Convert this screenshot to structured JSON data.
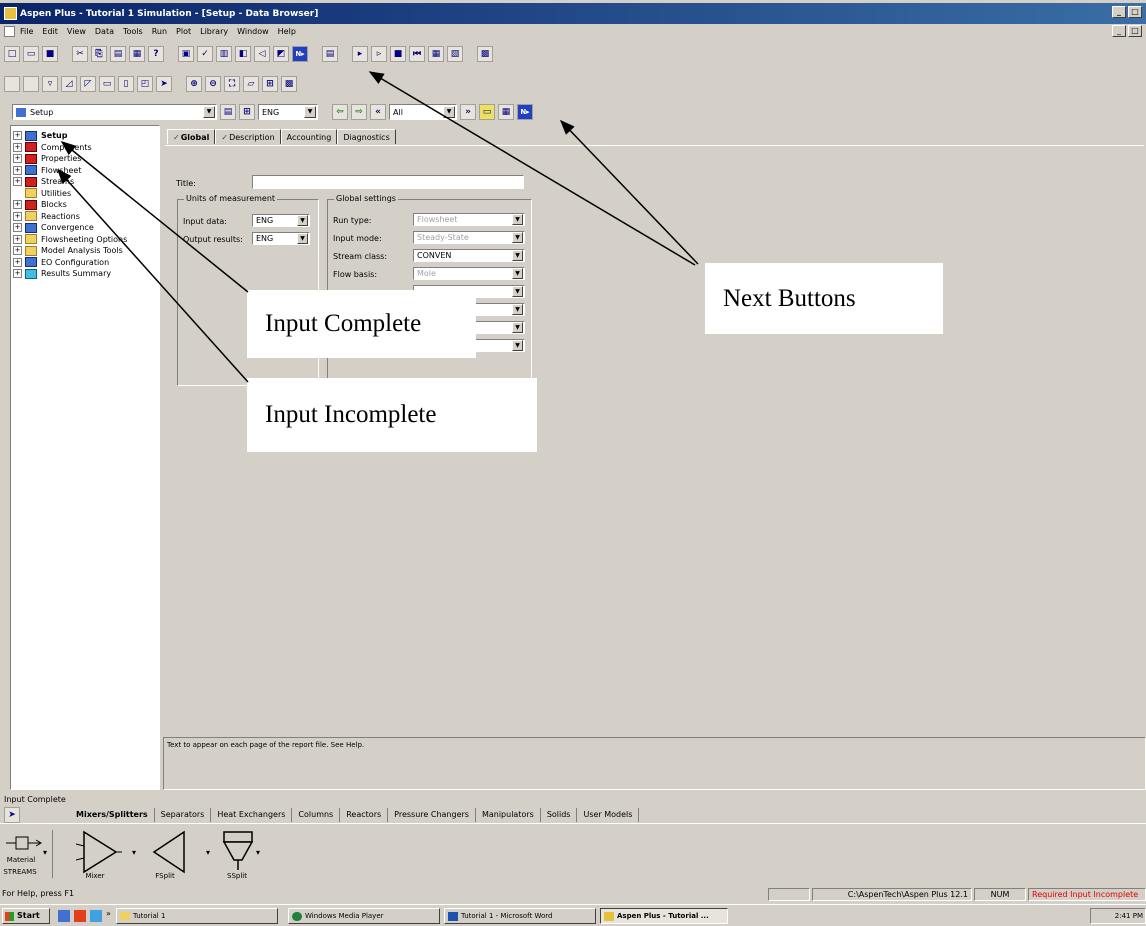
{
  "window": {
    "title": "Aspen Plus - Tutorial 1 Simulation - [Setup - Data Browser]"
  },
  "menu": [
    "File",
    "Edit",
    "View",
    "Data",
    "Tools",
    "Run",
    "Plot",
    "Library",
    "Window",
    "Help"
  ],
  "browser_bar": {
    "form_value": "Setup",
    "units_value": "ENG",
    "section_value": "All"
  },
  "tree": [
    {
      "label": "Setup",
      "icon": "blue-check-icon",
      "expand": true,
      "bold": true
    },
    {
      "label": "Components",
      "icon": "red-incomplete-icon",
      "expand": true
    },
    {
      "label": "Properties",
      "icon": "red-incomplete-icon",
      "expand": true
    },
    {
      "label": "Flowsheet",
      "icon": "blue-check-icon",
      "expand": true
    },
    {
      "label": "Streams",
      "icon": "red-incomplete-icon",
      "expand": true
    },
    {
      "label": "Utilities",
      "icon": "folder-icon",
      "expand": false
    },
    {
      "label": "Blocks",
      "icon": "red-incomplete-icon",
      "expand": true
    },
    {
      "label": "Reactions",
      "icon": "folder-icon",
      "expand": true
    },
    {
      "label": "Convergence",
      "icon": "blue-check-icon",
      "expand": true
    },
    {
      "label": "Flowsheeting Options",
      "icon": "folder-icon",
      "expand": true
    },
    {
      "label": "Model Analysis Tools",
      "icon": "folder-icon",
      "expand": true
    },
    {
      "label": "EO Configuration",
      "icon": "blue-check-icon",
      "expand": true
    },
    {
      "label": "Results Summary",
      "icon": "cyan-folder-icon",
      "expand": true
    }
  ],
  "tabs": [
    "Global",
    "Description",
    "Accounting",
    "Diagnostics"
  ],
  "form": {
    "title_label": "Title:",
    "title_value": "",
    "units_group": "Units of measurement",
    "input_data_label": "Input data:",
    "input_data_value": "ENG",
    "output_results_label": "Output results:",
    "output_results_value": "ENG",
    "global_group": "Global settings",
    "run_type_label": "Run type:",
    "run_type_value": "Flowsheet",
    "input_mode_label": "Input mode:",
    "input_mode_value": "Steady-State",
    "stream_class_label": "Stream class:",
    "stream_class_value": "CONVEN",
    "flow_basis_label": "Flow basis:",
    "flow_basis_value": "Mole"
  },
  "help_text": "Text to appear on each page of the report file. See Help.",
  "status_top": "Input Complete",
  "library_tabs": [
    "Mixers/Splitters",
    "Separators",
    "Heat Exchangers",
    "Columns",
    "Reactors",
    "Pressure Changers",
    "Manipulators",
    "Solids",
    "User Models"
  ],
  "palette": {
    "stream_label1": "Material",
    "stream_label2": "STREAMS",
    "items": [
      "Mixer",
      "FSplit",
      "SSplit"
    ]
  },
  "statusbar": {
    "help": "For Help, press F1",
    "path": "C:\\AspenTech\\Aspen Plus 12.1",
    "num": "NUM",
    "required": "Required Input Incomplete"
  },
  "taskbar": {
    "start": "Start",
    "items": [
      "Tutorial 1",
      "Windows Media Player",
      "Tutorial 1 - Microsoft Word",
      "Aspen Plus - Tutorial ..."
    ],
    "clock": "2:41 PM"
  },
  "callouts": {
    "next": "Next Buttons",
    "complete": "Input Complete",
    "incomplete": "Input Incomplete"
  }
}
